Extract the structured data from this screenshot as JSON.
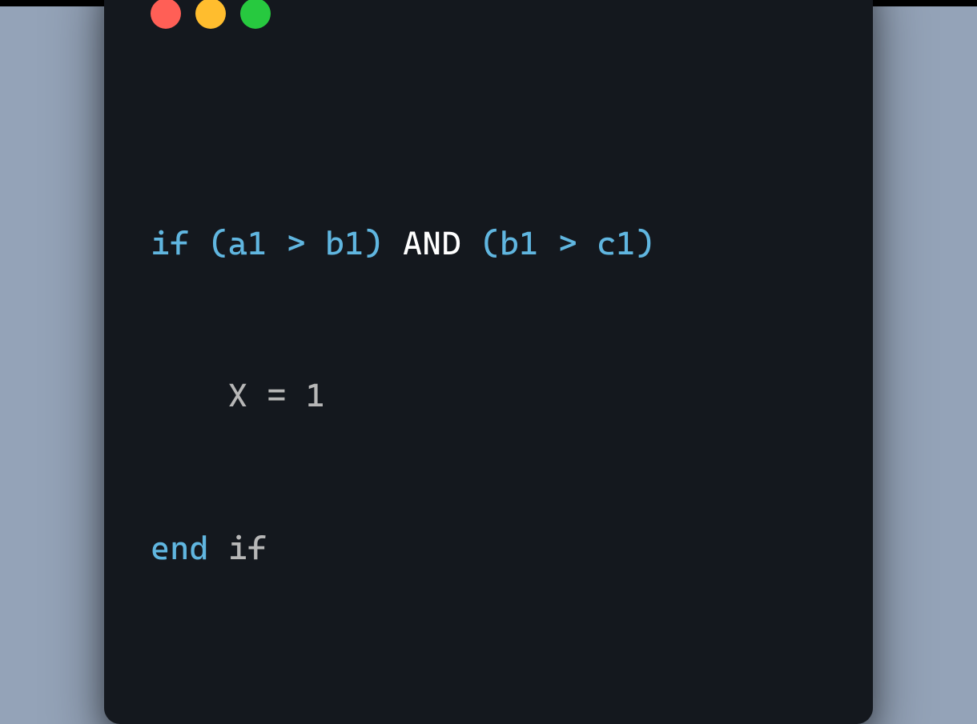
{
  "code": {
    "line1": {
      "t1": "if",
      "t2": " (a1 ",
      "t3": ">",
      "t4": " b1) ",
      "t5": "AND",
      "t6": " (b1 ",
      "t7": ">",
      "t8": " c1)"
    },
    "line2": {
      "t1": "    X ",
      "t2": "=",
      "t3": " ",
      "t4": "1"
    },
    "line3": {
      "t1": "end",
      "t2": " ",
      "t3": "if"
    }
  }
}
